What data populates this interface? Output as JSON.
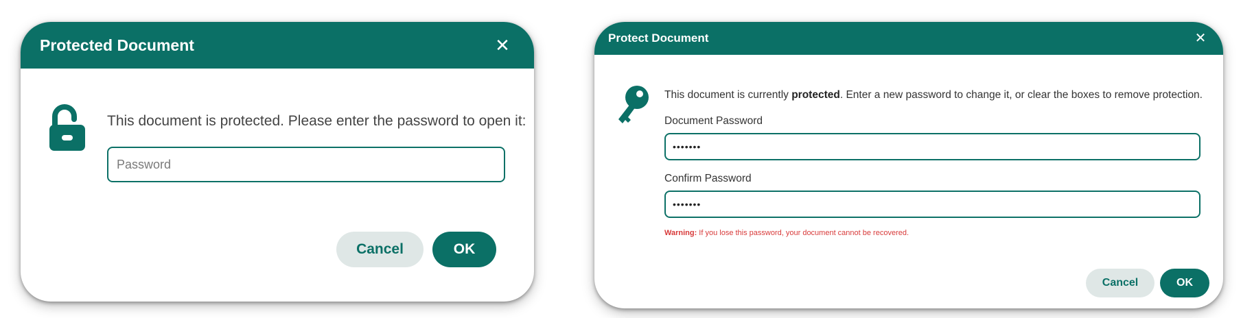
{
  "colors": {
    "accent": "#0b7066",
    "cancel_bg": "#dfe7e6",
    "warning": "#d83a3a"
  },
  "dialog1": {
    "title": "Protected Document",
    "close_icon": "close-icon",
    "icon": "unlocked-padlock-icon",
    "message": "This document is protected. Please enter the password to open it:",
    "password_value": "",
    "password_placeholder": "Password",
    "cancel_label": "Cancel",
    "ok_label": "OK"
  },
  "dialog2": {
    "title": "Protect Document",
    "close_icon": "close-icon",
    "icon": "key-icon",
    "message_pre": "This document is currently ",
    "message_bold": "protected",
    "message_post": ". Enter a new password to change it, or clear the boxes to remove protection.",
    "doc_password_label": "Document Password",
    "doc_password_value": "•••••••",
    "confirm_password_label": "Confirm Password",
    "confirm_password_value": "•••••••",
    "warning_prefix": "Warning:",
    "warning_text": " If you lose this password, your document cannot be recovered.",
    "cancel_label": "Cancel",
    "ok_label": "OK"
  }
}
